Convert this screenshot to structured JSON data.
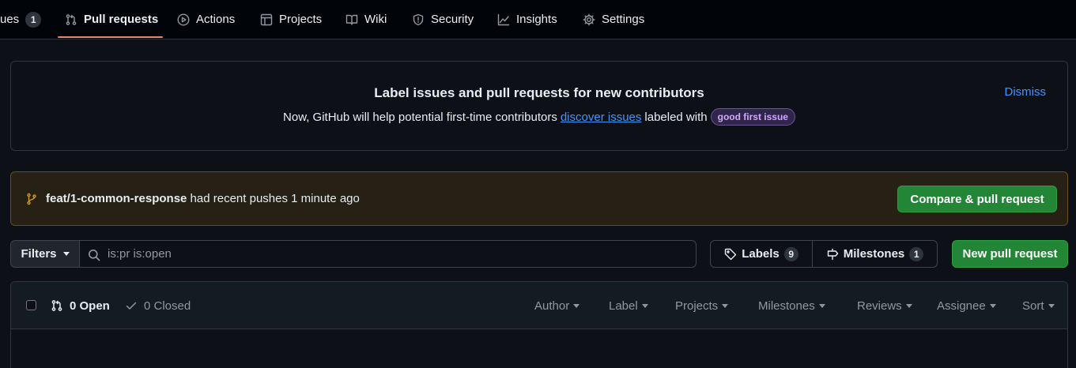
{
  "nav": {
    "items": [
      {
        "label": "ues",
        "badge": "1",
        "icon": "issue-icon"
      },
      {
        "label": "Pull requests",
        "icon": "git-pull-request-icon",
        "active": true
      },
      {
        "label": "Actions",
        "icon": "play-icon"
      },
      {
        "label": "Projects",
        "icon": "table-icon"
      },
      {
        "label": "Wiki",
        "icon": "book-icon"
      },
      {
        "label": "Security",
        "icon": "shield-icon"
      },
      {
        "label": "Insights",
        "icon": "graph-icon"
      },
      {
        "label": "Settings",
        "icon": "gear-icon"
      }
    ]
  },
  "contrib_banner": {
    "title": "Label issues and pull requests for new contributors",
    "text_before": "Now, GitHub will help potential first-time contributors",
    "link": "discover issues",
    "text_after": "labeled with",
    "label": "good first issue",
    "dismiss": "Dismiss"
  },
  "push_banner": {
    "branch": "feat/1-common-response",
    "message": "had recent pushes 1 minute ago",
    "button": "Compare & pull request"
  },
  "toolbar": {
    "filters": "Filters",
    "search_value": "is:pr is:open",
    "labels": "Labels",
    "labels_count": "9",
    "milestones": "Milestones",
    "milestones_count": "1",
    "new_pr": "New pull request"
  },
  "list": {
    "open": "0 Open",
    "closed": "0 Closed",
    "filters": [
      "Author",
      "Label",
      "Projects",
      "Milestones",
      "Reviews",
      "Assignee",
      "Sort"
    ]
  },
  "colors": {
    "accent_link": "#4493f8",
    "tab_underline": "#f78166",
    "primary_button": "#238636",
    "warning_branch": "#d29922"
  }
}
